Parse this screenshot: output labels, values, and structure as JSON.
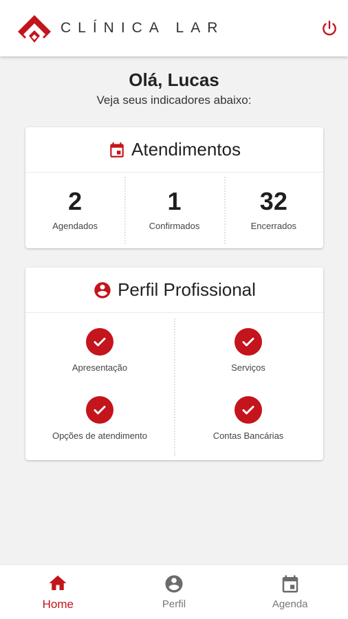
{
  "brand": {
    "name": "CLÍNICA LAR"
  },
  "colors": {
    "accent": "#c4141c",
    "inactive": "#777777"
  },
  "header": {
    "power_icon": "power-icon"
  },
  "greeting": {
    "title": "Olá, Lucas",
    "subtitle": "Veja seus indicadores abaixo:"
  },
  "atendimentos": {
    "title": "Atendimentos",
    "icon": "calendar-icon",
    "stats": [
      {
        "value": "2",
        "label": "Agendados"
      },
      {
        "value": "1",
        "label": "Confirmados"
      },
      {
        "value": "32",
        "label": "Encerrados"
      }
    ]
  },
  "perfil": {
    "title": "Perfil Profissional",
    "icon": "account-circle-icon",
    "items": [
      {
        "label": "Apresentação",
        "status": "complete"
      },
      {
        "label": "Serviços",
        "status": "complete"
      },
      {
        "label": "Opções de atendimento",
        "status": "complete"
      },
      {
        "label": "Contas Bancárias",
        "status": "complete"
      }
    ]
  },
  "nav": {
    "items": [
      {
        "label": "Home",
        "icon": "home-icon",
        "active": true
      },
      {
        "label": "Perfil",
        "icon": "account-circle-icon",
        "active": false
      },
      {
        "label": "Agenda",
        "icon": "calendar-icon",
        "active": false
      }
    ]
  }
}
